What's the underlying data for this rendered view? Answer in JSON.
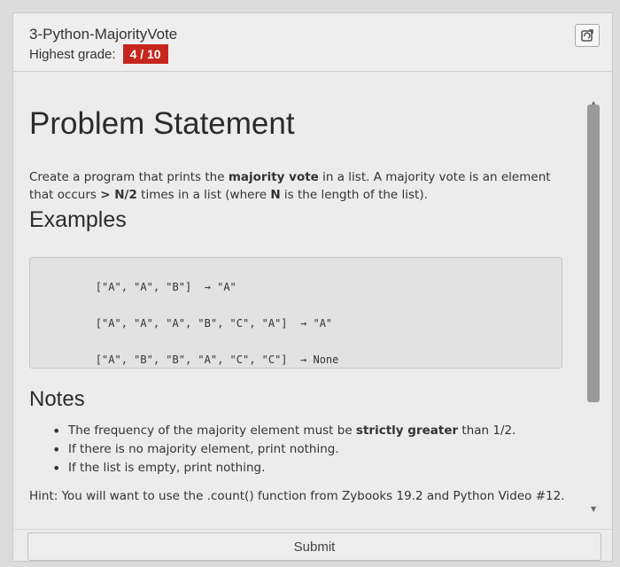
{
  "header": {
    "title": "3-Python-MajorityVote",
    "grade_label": "Highest grade:",
    "grade_value": "4 / 10"
  },
  "problem": {
    "heading": "Problem Statement",
    "statement": [
      {
        "text": "Create a program that prints the ",
        "bold": false
      },
      {
        "text": "majority vote",
        "bold": true
      },
      {
        "text": " in a list. A majority vote is an element that occurs ",
        "bold": false
      },
      {
        "text": "> N/2",
        "bold": true
      },
      {
        "text": " times in a list (where ",
        "bold": false
      },
      {
        "text": "N",
        "bold": true
      },
      {
        "text": " is the length of the list).",
        "bold": false
      }
    ]
  },
  "examples": {
    "heading": "Examples",
    "items": [
      {
        "input": "[\"A\", \"A\", \"B\"]",
        "arrow": "→",
        "output": "\"A\""
      },
      {
        "input": "[\"A\", \"A\", \"A\", \"B\", \"C\", \"A\"]",
        "arrow": "→",
        "output": "\"A\""
      },
      {
        "input": "[\"A\", \"B\", \"B\", \"A\", \"C\", \"C\"]",
        "arrow": "→",
        "output": "None"
      }
    ]
  },
  "notes": {
    "heading": "Notes",
    "items": [
      [
        {
          "text": "The frequency of the majority element must be ",
          "bold": false
        },
        {
          "text": "strictly greater",
          "bold": true
        },
        {
          "text": " than 1/2.",
          "bold": false
        }
      ],
      [
        {
          "text": "If there is no majority element, print nothing.",
          "bold": false
        }
      ],
      [
        {
          "text": "If the list is empty, print nothing.",
          "bold": false
        }
      ]
    ]
  },
  "hint": "Hint: You will want to use the .count() function from Zybooks 19.2 and Python Video #12.",
  "submit_label": "Submit",
  "icons": {
    "refresh": "refresh-icon",
    "scroll_up": "scroll-up-arrow-icon",
    "scroll_down": "scroll-down-arrow-icon"
  },
  "colors": {
    "grade_badge": "#c5271f"
  }
}
